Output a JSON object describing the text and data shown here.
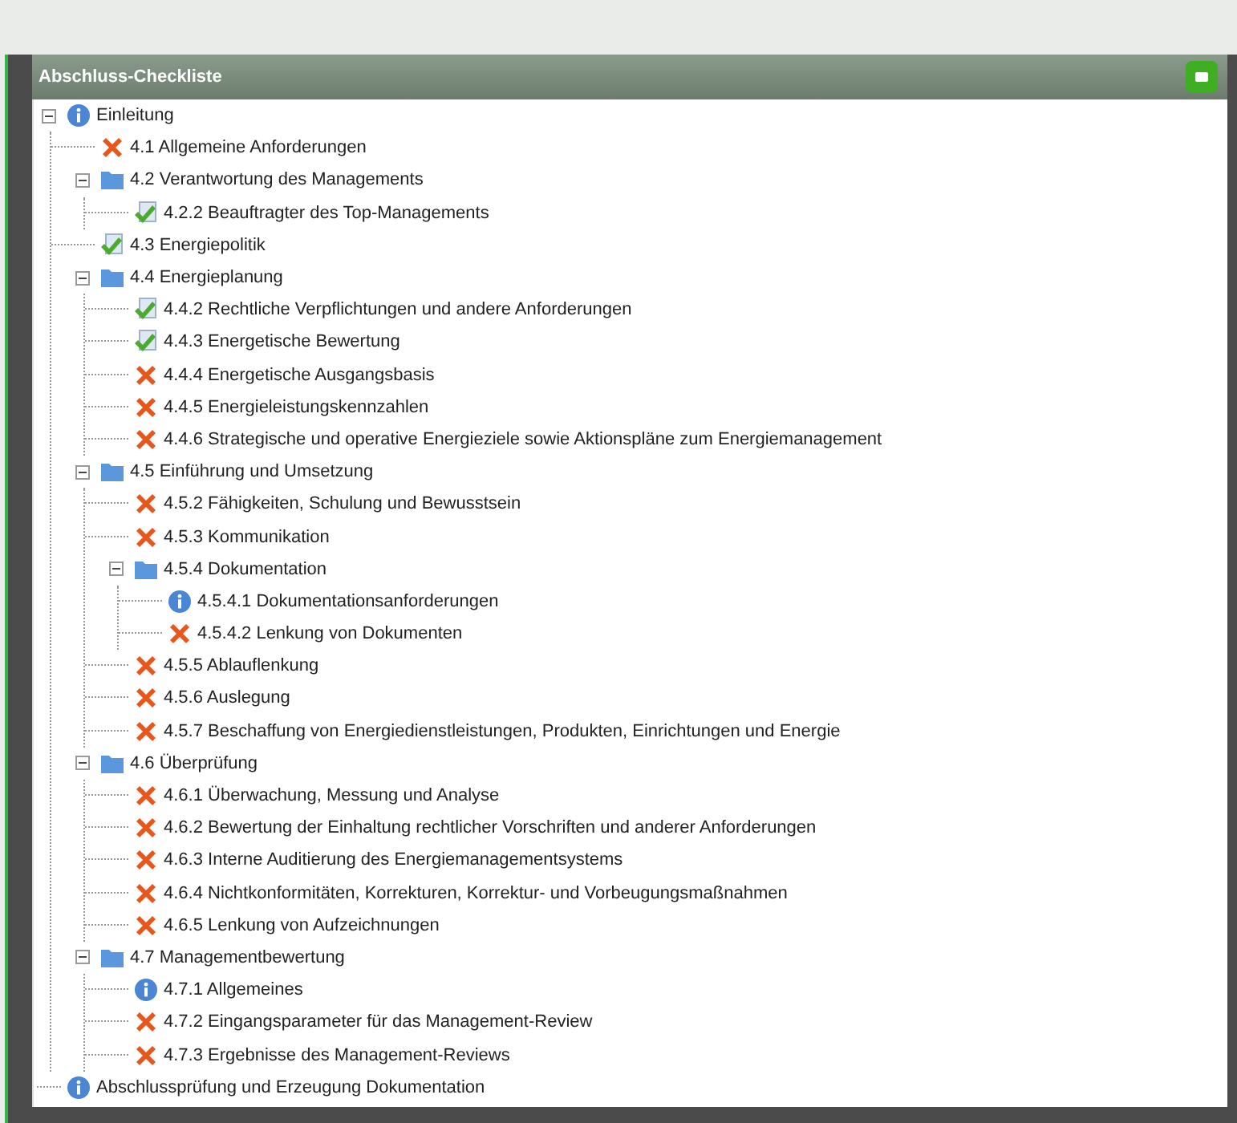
{
  "panel": {
    "title": "Abschluss-Checkliste"
  },
  "tree": [
    {
      "label": "Einleitung",
      "kind": "info",
      "expanded": true,
      "children": [
        {
          "label": "4.1 Allgemeine Anforderungen",
          "kind": "open"
        },
        {
          "label": "4.2 Verantwortung des Managements",
          "kind": "folder",
          "expanded": true,
          "children": [
            {
              "label": "4.2.2 Beauftragter des Top-Managements",
              "kind": "done"
            }
          ]
        },
        {
          "label": "4.3 Energiepolitik",
          "kind": "done"
        },
        {
          "label": "4.4 Energieplanung",
          "kind": "folder",
          "expanded": true,
          "children": [
            {
              "label": "4.4.2 Rechtliche Verpflichtungen und andere Anforderungen",
              "kind": "done"
            },
            {
              "label": "4.4.3 Energetische Bewertung",
              "kind": "done"
            },
            {
              "label": "4.4.4 Energetische Ausgangsbasis",
              "kind": "open"
            },
            {
              "label": "4.4.5 Energieleistungskennzahlen",
              "kind": "open"
            },
            {
              "label": "4.4.6 Strategische und operative Energieziele sowie Aktionspläne zum Energiemanagement",
              "kind": "open"
            }
          ]
        },
        {
          "label": "4.5 Einführung und Umsetzung",
          "kind": "folder",
          "expanded": true,
          "children": [
            {
              "label": "4.5.2 Fähigkeiten, Schulung und Bewusstsein",
              "kind": "open"
            },
            {
              "label": "4.5.3 Kommunikation",
              "kind": "open"
            },
            {
              "label": "4.5.4 Dokumentation",
              "kind": "folder",
              "expanded": true,
              "children": [
                {
                  "label": "4.5.4.1 Dokumentationsanforderungen",
                  "kind": "info"
                },
                {
                  "label": "4.5.4.2 Lenkung von Dokumenten",
                  "kind": "open"
                }
              ]
            },
            {
              "label": "4.5.5 Ablauflenkung",
              "kind": "open"
            },
            {
              "label": "4.5.6 Auslegung",
              "kind": "open"
            },
            {
              "label": "4.5.7 Beschaffung von Energiedienstleistungen, Produkten, Einrichtungen und Energie",
              "kind": "open"
            }
          ]
        },
        {
          "label": "4.6 Überprüfung",
          "kind": "folder",
          "expanded": true,
          "children": [
            {
              "label": "4.6.1 Überwachung, Messung und Analyse",
              "kind": "open"
            },
            {
              "label": "4.6.2 Bewertung der Einhaltung rechtlicher Vorschriften und anderer Anforderungen",
              "kind": "open"
            },
            {
              "label": "4.6.3 Interne Auditierung des Energiemanagementsystems",
              "kind": "open"
            },
            {
              "label": "4.6.4 Nichtkonformitäten, Korrekturen, Korrektur- und Vorbeugungsmaßnahmen",
              "kind": "open"
            },
            {
              "label": "4.6.5 Lenkung von Aufzeichnungen",
              "kind": "open"
            }
          ]
        },
        {
          "label": "4.7 Managementbewertung",
          "kind": "folder",
          "expanded": true,
          "children": [
            {
              "label": "4.7.1 Allgemeines",
              "kind": "info"
            },
            {
              "label": "4.7.2 Eingangsparameter für das Management-Review",
              "kind": "open"
            },
            {
              "label": "4.7.3 Ergebnisse des Management-Reviews",
              "kind": "open"
            }
          ]
        }
      ]
    },
    {
      "label": "Abschlussprüfung und Erzeugung Dokumentation",
      "kind": "info"
    }
  ]
}
